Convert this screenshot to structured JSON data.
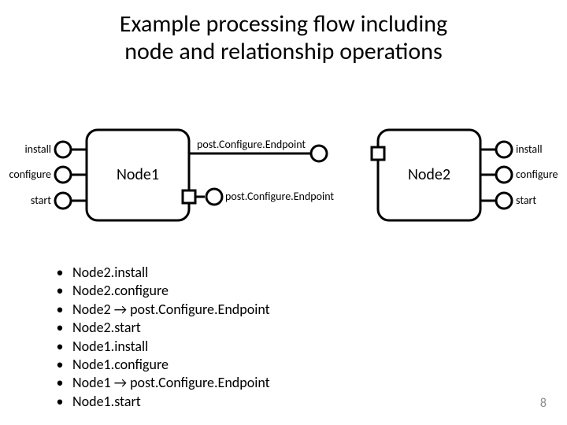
{
  "title_line1": "Example processing flow including",
  "title_line2": "node and relationship operations",
  "labels": {
    "install": "install",
    "configure": "configure",
    "start": "start",
    "pce": "post.Configure.Endpoint"
  },
  "nodes": {
    "node1": "Node1",
    "node2": "Node2"
  },
  "bullets": [
    "Node2.install",
    "Node2.configure",
    "Node2 → post.Configure.Endpoint",
    "Node2.start",
    "Node1.install",
    "Node1.configure",
    "Node1 → post.Configure.Endpoint",
    "Node1.start"
  ],
  "page_number": "8"
}
